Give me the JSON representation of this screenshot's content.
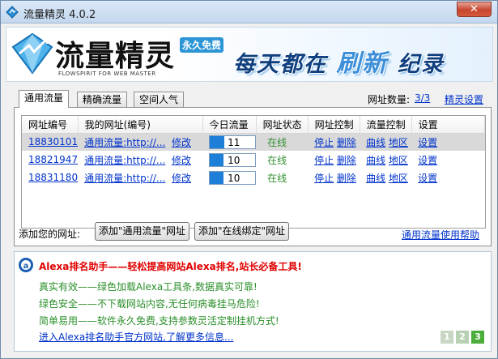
{
  "window": {
    "title": "流量精灵 4.0.2",
    "close_label": "✕"
  },
  "banner": {
    "logo_text": "流量精灵",
    "logo_sub": "FLOWSPIRIT FOR WEB MASTER",
    "free_badge": "永久免费",
    "slogan_part1": "每天都在",
    "slogan_highlight": "刷新",
    "slogan_part2": "纪录"
  },
  "tabs": [
    {
      "label": "通用流量",
      "active": true
    },
    {
      "label": "精确流量",
      "active": false
    },
    {
      "label": "空间人气",
      "active": false
    }
  ],
  "info": {
    "count_label": "网址数量:",
    "count_value": "3/3",
    "settings_link": "精灵设置"
  },
  "table": {
    "headers": [
      "网址编号",
      "我的网址(编号)",
      "今日流量",
      "网址状态",
      "网址控制",
      "流量控制",
      "设置"
    ],
    "rows": [
      {
        "id": "18830101",
        "url": "通用流量:http://...",
        "edit": "修改",
        "traffic": "11",
        "traffic_fraction": 0.32,
        "status": "在线",
        "stop": "停止",
        "delete": "删除",
        "curve": "曲线",
        "region": "地区",
        "settings": "设置",
        "selected": true
      },
      {
        "id": "18821947",
        "url": "通用流量:http://...",
        "edit": "修改",
        "traffic": "10",
        "traffic_fraction": 0.3,
        "status": "在线",
        "stop": "停止",
        "delete": "删除",
        "curve": "曲线",
        "region": "地区",
        "settings": "设置",
        "selected": false
      },
      {
        "id": "18831180",
        "url": "通用流量:http://...",
        "edit": "修改",
        "traffic": "10",
        "traffic_fraction": 0.3,
        "status": "在线",
        "stop": "停止",
        "delete": "删除",
        "curve": "曲线",
        "region": "地区",
        "settings": "设置",
        "selected": false
      }
    ]
  },
  "actions": {
    "add_label": "添加您的网址:",
    "add_general": "添加\"通用流量\"网址",
    "add_online": "添加\"在线绑定\"网址",
    "help_link": "通用流量使用帮助"
  },
  "ad": {
    "title": "Alexa排名助手——轻松提高网站Alexa排名,站长必备工具!",
    "lines": [
      "真实有效——绿色加载Alexa工具条,数据真实可靠!",
      "绿色安全——不下载网站内容,无任何病毒挂马危险!",
      "简单易用——软件永久免费,支持参数灵活定制挂机方式!"
    ],
    "link": "进入Alexa排名助手官方网站,了解更多信息...",
    "pages": [
      "1",
      "2",
      "3"
    ]
  },
  "colors": {
    "accent": "#1e7fd8",
    "status_online": "#2f8f2f",
    "ad_title": "#e00000",
    "link": "#0033cc"
  }
}
